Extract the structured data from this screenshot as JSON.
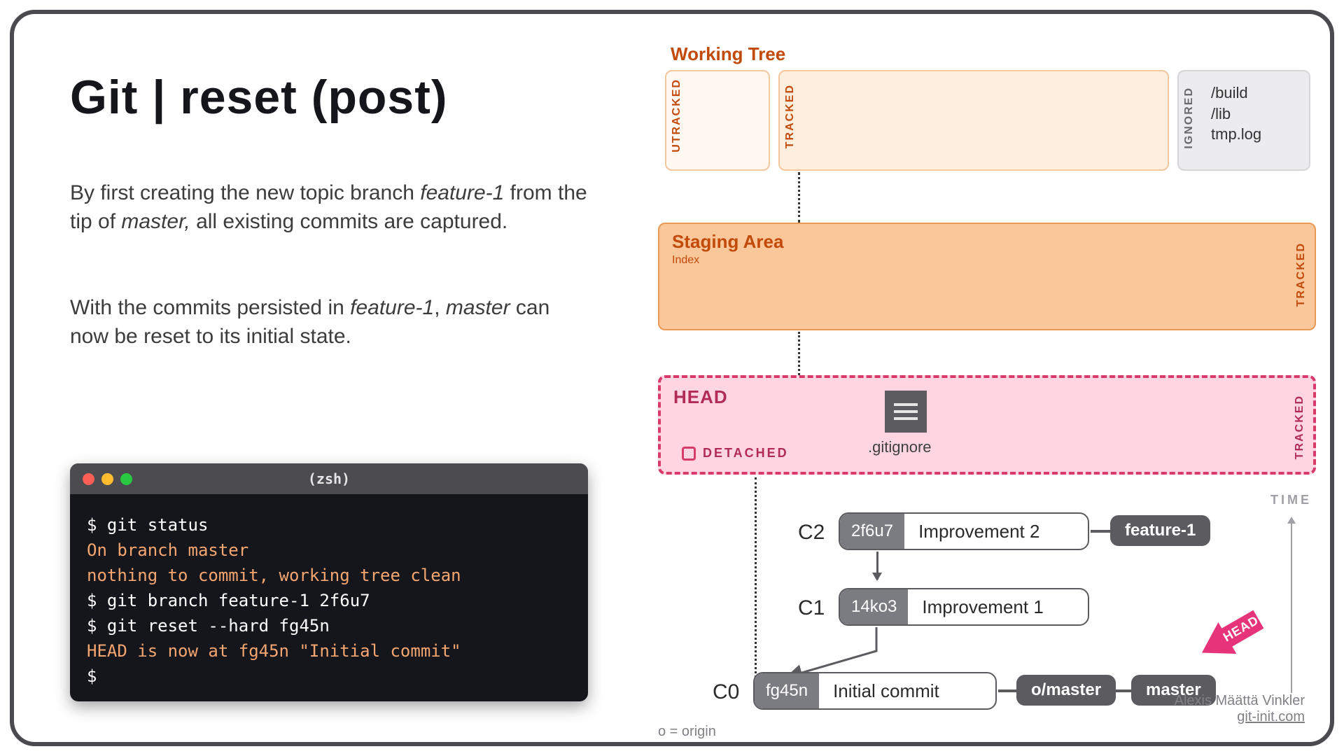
{
  "title": "Git | reset (post)",
  "para1_a": "By first creating the new topic branch ",
  "para1_em1": "feature-1",
  "para1_b": " from the tip of ",
  "para1_em2": "master,",
  "para1_c": " all existing commits are captured.",
  "para2_a": "With the commits persisted in ",
  "para2_em1": "feature-1",
  "para2_b": ", ",
  "para2_em2": "master",
  "para2_c": " can now be reset to its initial state.",
  "terminal": {
    "title": "(zsh)",
    "dot_red": "#fd5f57",
    "dot_yellow": "#febc2e",
    "dot_green": "#28c840",
    "lines": [
      {
        "prompt": "$ ",
        "cmd": "git status"
      },
      {
        "orange": "On branch master"
      },
      {
        "orange": "nothing to commit, working tree clean"
      },
      {
        "prompt": "$ ",
        "cmd": "git branch feature-1 2f6u7"
      },
      {
        "prompt": "$ ",
        "cmd": "git reset --hard fg45n"
      },
      {
        "orange": "HEAD is now at fg45n \"Initial commit\""
      },
      {
        "prompt": "$ ",
        "cmd": ""
      }
    ]
  },
  "working_tree": {
    "title": "Working Tree",
    "box_utracked": "UTRACKED",
    "box_tracked": "TRACKED",
    "box_ignored": "IGNORED",
    "ignored_files": [
      "/build",
      "/lib",
      "tmp.log"
    ],
    "bg": "#fff1e6",
    "border": "#f0b083"
  },
  "staging": {
    "title": "Staging Area",
    "sub": "Index",
    "bg": "#f9c79a",
    "border": "#e89a55",
    "tracked": "TRACKED"
  },
  "head": {
    "title": "HEAD",
    "detached": "DETACHED",
    "file": ".gitignore",
    "tracked": "TRACKED",
    "bg": "#ffd5e1",
    "border": "#d83a6a"
  },
  "commits": [
    {
      "id": "C2",
      "hash": "2f6u7",
      "msg": "Improvement 2",
      "branches": [
        "feature-1"
      ]
    },
    {
      "id": "C1",
      "hash": "14ko3",
      "msg": "Improvement 1",
      "branches": []
    },
    {
      "id": "C0",
      "hash": "fg45n",
      "msg": "Initial commit",
      "branches": [
        "o/master",
        "master"
      ]
    }
  ],
  "time": "TIME",
  "head_pointer": "HEAD",
  "legend": "o = origin",
  "credit_name": "Alexis Määttä Vinkler",
  "credit_link": "git-init.com"
}
